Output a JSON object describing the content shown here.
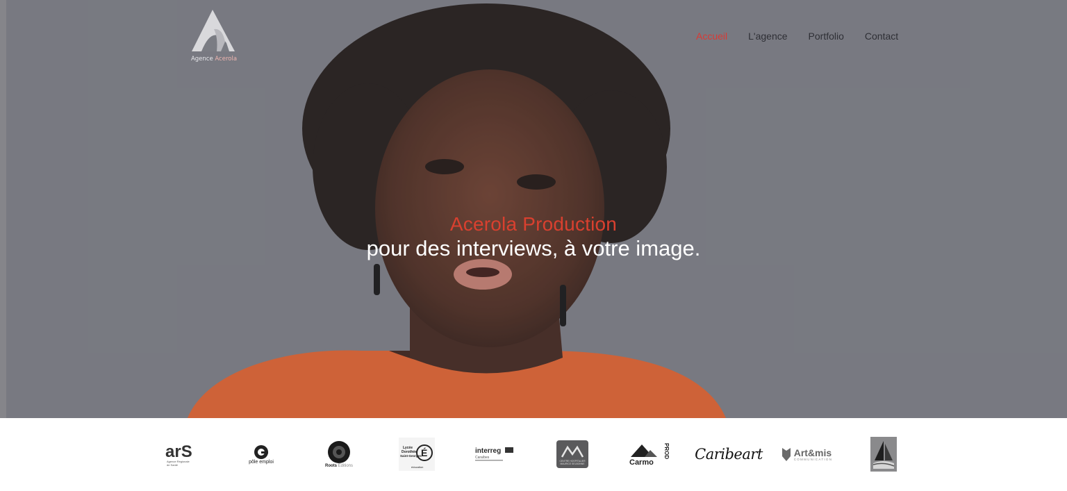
{
  "brand": {
    "logo_word1": "Agence",
    "logo_word2": "Acerola"
  },
  "nav": {
    "items": [
      "Accueil",
      "L'agence",
      "Portfolio",
      "Contact"
    ],
    "active": "Accueil"
  },
  "hero": {
    "title": "Acerola Production",
    "subtitle": "pour des interviews, à votre image."
  },
  "partners": {
    "ars": {
      "big": "arS",
      "small1": "Agence Régionale",
      "small2": "de Santé"
    },
    "pole_emploi": {
      "label": "pôle emploi"
    },
    "roots": {
      "label": "Roots",
      "label2": "Éditions"
    },
    "lycee": {
      "l1": "Lycée",
      "l2": "Dorothée",
      "l3": "Saint-Georges",
      "l4": "éducation"
    },
    "interreg": {
      "label": "interreg",
      "sub": "Caraïbes"
    },
    "chmb": {
      "label": "CENTRE HOSPITALIER",
      "label2": "MAURICE SELBONNE"
    },
    "carmo": {
      "label": "Carmo",
      "side": "PROD"
    },
    "caribeart": {
      "label": "Caribeart"
    },
    "artemis": {
      "label": "Art&mis",
      "sub": "COMMUNICATION"
    },
    "sailboat": {
      "label": ""
    }
  },
  "colors": {
    "accent": "#d83a35",
    "nav_text": "#2e2f35",
    "hero_bg": "#7a7c83"
  }
}
